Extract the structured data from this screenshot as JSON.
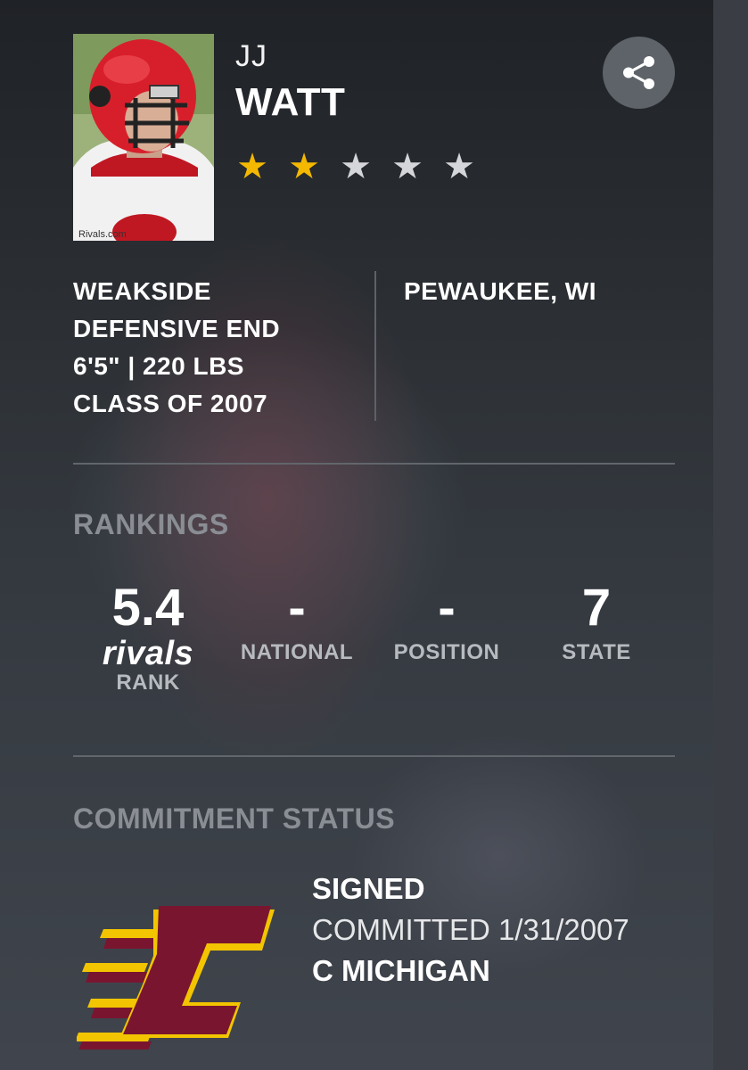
{
  "player": {
    "first_name": "JJ",
    "last_name": "WATT",
    "photo_caption": "Rivals.com",
    "stars_filled": 2,
    "stars_total": 5,
    "star_filled_color": "#f5b800",
    "star_empty_color": "#d4d6d9"
  },
  "bio": {
    "position_line1": "WEAKSIDE",
    "position_line2": "DEFENSIVE END",
    "size": "6'5\" | 220 LBS",
    "class": "CLASS OF 2007",
    "hometown": "PEWAUKEE, WI"
  },
  "rankings": {
    "title": "RANKINGS",
    "rivals": {
      "value": "5.4",
      "logo_text": "rivals",
      "label": "RANK"
    },
    "national": {
      "value": "-",
      "label": "NATIONAL"
    },
    "position": {
      "value": "-",
      "label": "POSITION"
    },
    "state": {
      "value": "7",
      "label": "STATE"
    }
  },
  "commitment": {
    "title": "COMMITMENT STATUS",
    "status": "SIGNED",
    "date_line": "COMMITTED 1/31/2007",
    "school": "C MICHIGAN",
    "school_colors": {
      "maroon": "#7a1530",
      "gold": "#f2c500"
    }
  },
  "icons": {
    "share": "share-icon",
    "star": "star-icon"
  }
}
